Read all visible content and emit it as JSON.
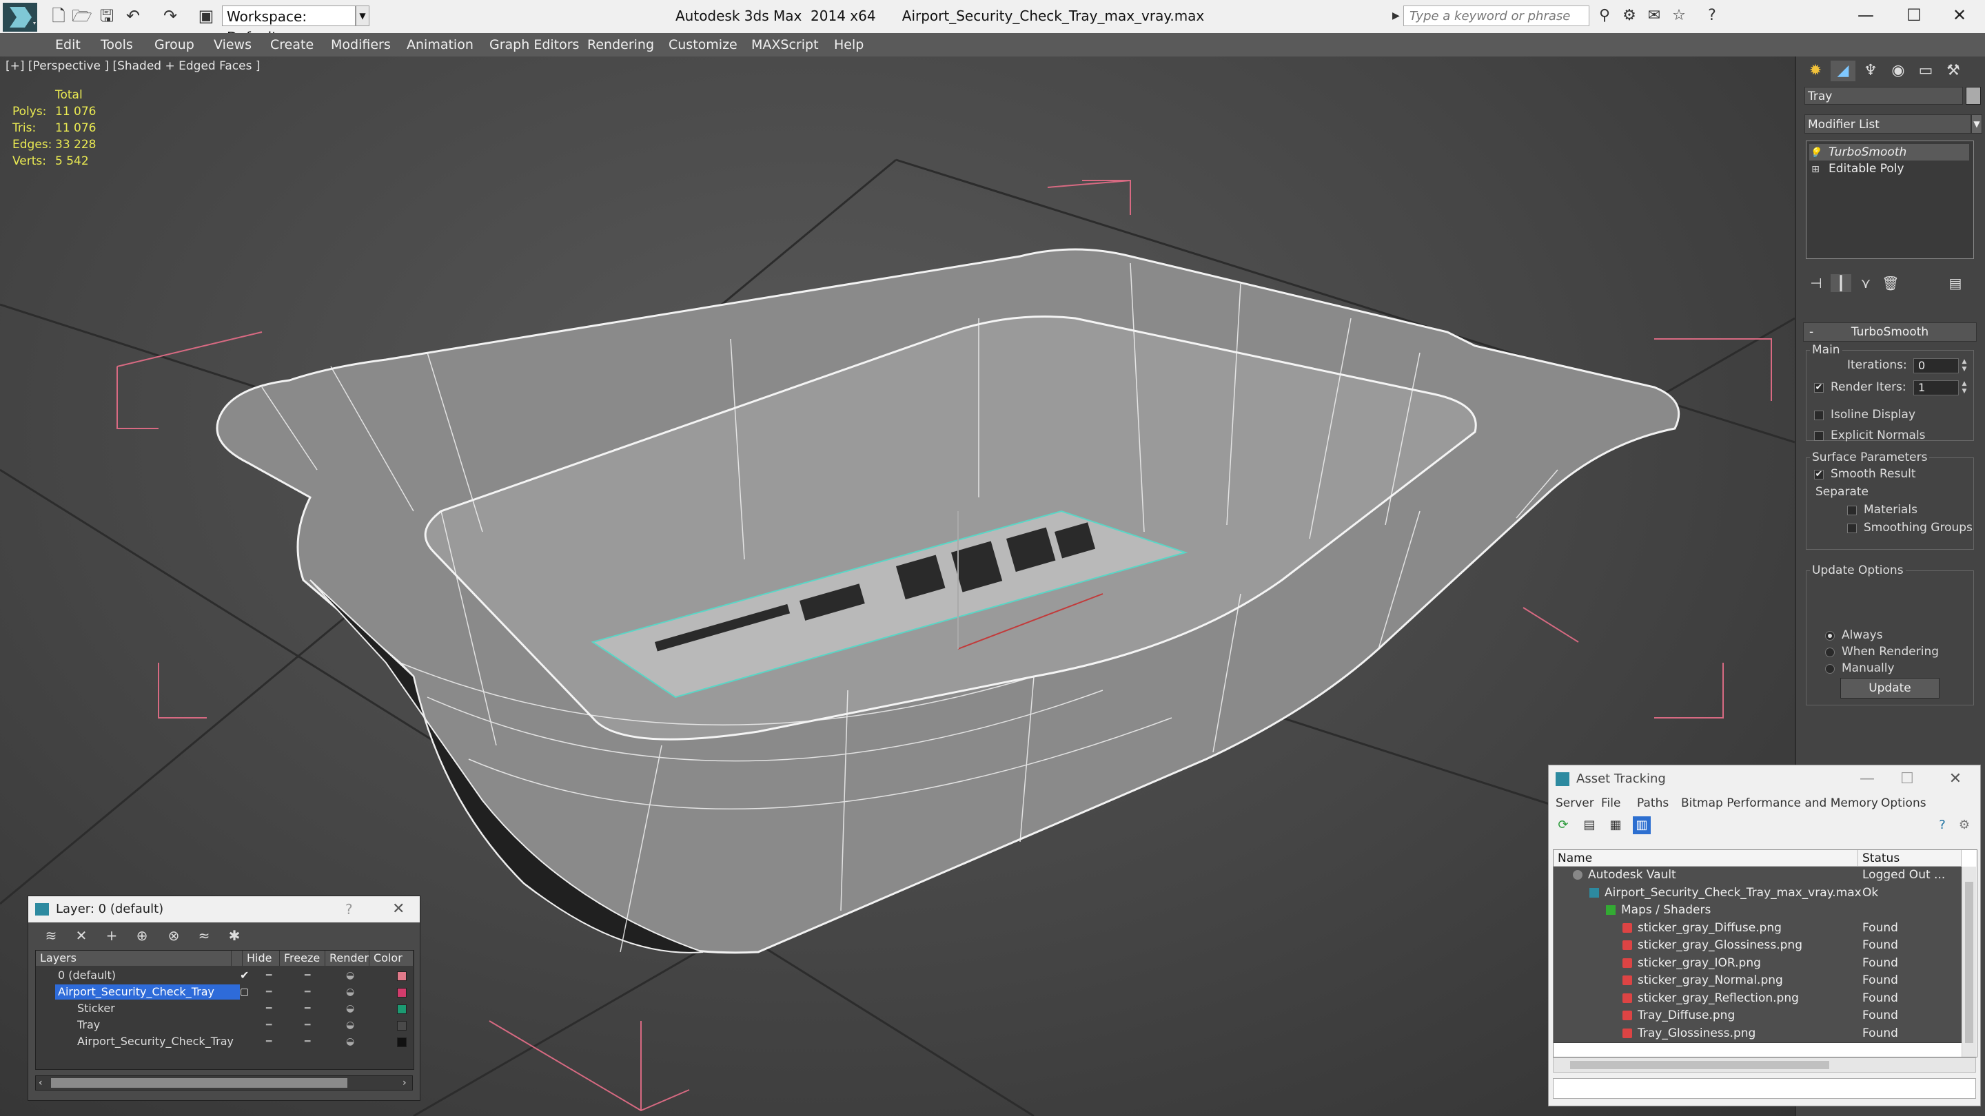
{
  "titlebar": {
    "workspace": "Workspace: Default",
    "app_title": "Autodesk 3ds Max  2014 x64",
    "file_title": "Airport_Security_Check_Tray_max_vray.max",
    "search_placeholder": "Type a keyword or phrase"
  },
  "menu": [
    "Edit",
    "Tools",
    "Group",
    "Views",
    "Create",
    "Modifiers",
    "Animation",
    "Graph Editors",
    "Rendering",
    "Customize",
    "MAXScript",
    "Help"
  ],
  "viewport": {
    "label": "[+] [Perspective ] [Shaded + Edged Faces ]",
    "stats": {
      "header": "Total",
      "rows": [
        {
          "label": "Polys:",
          "value": "11 076"
        },
        {
          "label": "Tris:",
          "value": "11 076"
        },
        {
          "label": "Edges:",
          "value": "33 228"
        },
        {
          "label": "Verts:",
          "value": "5 542"
        }
      ]
    }
  },
  "command_panel": {
    "object_name": "Tray",
    "modifier_list": "Modifier List",
    "stack": [
      "TurboSmooth",
      "Editable Poly"
    ],
    "turbosmooth": {
      "header": "TurboSmooth",
      "main_group": "Main",
      "iterations_label": "Iterations:",
      "iterations_value": "0",
      "render_iters_label": "Render Iters:",
      "render_iters_value": "1",
      "render_iters_checked": true,
      "isoline_label": "Isoline Display",
      "isoline_checked": false,
      "explicit_label": "Explicit Normals",
      "explicit_checked": false,
      "surface_group": "Surface Parameters",
      "smooth_label": "Smooth Result",
      "smooth_checked": true,
      "separate_label": "Separate",
      "materials_label": "Materials",
      "materials_checked": false,
      "smoothing_label": "Smoothing Groups",
      "smoothing_checked": false,
      "update_group": "Update Options",
      "always_label": "Always",
      "when_rendering_label": "When Rendering",
      "manually_label": "Manually",
      "selected_update": "Always",
      "update_button": "Update"
    }
  },
  "layer_dialog": {
    "title": "Layer: 0 (default)",
    "help": "?",
    "columns": [
      "Layers",
      "Hide",
      "Freeze",
      "Render",
      "Color"
    ],
    "rows": [
      {
        "name": "0 (default)",
        "indent": 0,
        "selected": false,
        "color": "#e07a8a"
      },
      {
        "name": "Airport_Security_Check_Tray",
        "indent": 0,
        "selected": true,
        "color": "#d23c6c"
      },
      {
        "name": "Sticker",
        "indent": 1,
        "selected": false,
        "color": "#1c9a72"
      },
      {
        "name": "Tray",
        "indent": 1,
        "selected": false,
        "color": "#4a4a4a"
      },
      {
        "name": "Airport_Security_Check_Tray",
        "indent": 1,
        "selected": false,
        "color": "#111111"
      }
    ]
  },
  "asset_dialog": {
    "title": "Asset Tracking",
    "menu": [
      "Server",
      "File",
      "Paths",
      "Bitmap Performance and Memory",
      "Options"
    ],
    "columns": [
      "Name",
      "Status"
    ],
    "rows": [
      {
        "name": "Autodesk Vault",
        "status": "Logged Out ...",
        "indent": 1,
        "icon": "vault"
      },
      {
        "name": "Airport_Security_Check_Tray_max_vray.max",
        "status": "Ok",
        "indent": 2,
        "icon": "max"
      },
      {
        "name": "Maps / Shaders",
        "status": "",
        "indent": 3,
        "icon": "maps"
      },
      {
        "name": "sticker_gray_Diffuse.png",
        "status": "Found",
        "indent": 4,
        "icon": "png"
      },
      {
        "name": "sticker_gray_Glossiness.png",
        "status": "Found",
        "indent": 4,
        "icon": "png"
      },
      {
        "name": "sticker_gray_IOR.png",
        "status": "Found",
        "indent": 4,
        "icon": "png"
      },
      {
        "name": "sticker_gray_Normal.png",
        "status": "Found",
        "indent": 4,
        "icon": "png"
      },
      {
        "name": "sticker_gray_Reflection.png",
        "status": "Found",
        "indent": 4,
        "icon": "png"
      },
      {
        "name": "Tray_Diffuse.png",
        "status": "Found",
        "indent": 4,
        "icon": "png"
      },
      {
        "name": "Tray_Glossiness.png",
        "status": "Found",
        "indent": 4,
        "icon": "png"
      }
    ]
  }
}
